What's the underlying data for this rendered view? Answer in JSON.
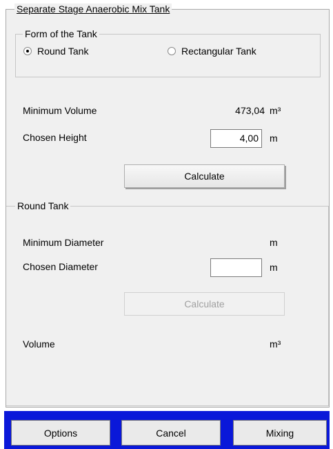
{
  "title": "Separate Stage Anaerobic Mix Tank",
  "form_group": {
    "legend": "Form of the Tank",
    "options": [
      {
        "label": "Round Tank",
        "checked": true
      },
      {
        "label": "Rectangular Tank",
        "checked": false
      }
    ]
  },
  "volume_section": {
    "min_volume_label": "Minimum Volume",
    "min_volume_value": "473,04",
    "min_volume_unit": "m³",
    "chosen_height_label": "Chosen Height",
    "chosen_height_value": "4,00",
    "chosen_height_unit": "m",
    "calculate_label": "Calculate"
  },
  "round_tank": {
    "legend": "Round Tank",
    "min_diameter_label": "Minimum Diameter",
    "min_diameter_unit": "m",
    "chosen_diameter_label": "Chosen Diameter",
    "chosen_diameter_value": "",
    "chosen_diameter_unit": "m",
    "calculate_label": "Calculate",
    "volume_label": "Volume",
    "volume_unit": "m³"
  },
  "footer": {
    "options_label": "Options",
    "cancel_label": "Cancel",
    "mixing_label": "Mixing",
    "bar_color": "#0a18d9"
  }
}
